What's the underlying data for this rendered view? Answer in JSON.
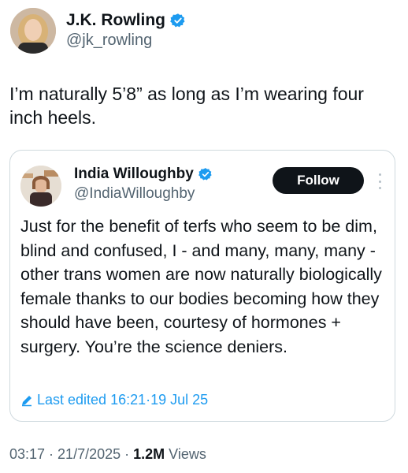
{
  "author": {
    "name": "J.K. Rowling",
    "handle": "@jk_rowling",
    "verified": true
  },
  "tweet": {
    "text": "I’m naturally 5’8” as long as I’m wearing four inch heels."
  },
  "quoted": {
    "name": "India Willoughby",
    "handle": "@IndiaWilloughby",
    "follow_label": "Follow",
    "text": "Just for the benefit of terfs who seem to be dim, blind and confused, I - and many, many, many - other trans women are now naturally biologically female thanks to our bodies becoming how they should have been, courtesy of hormones + surgery. You’re the science deniers.",
    "edited_label": "Last edited 16:21",
    "edited_sep": " · ",
    "edited_date": "19 Jul 25"
  },
  "meta": {
    "time": "03:17",
    "sep1": " · ",
    "date": "21/7/2025",
    "sep2": " · ",
    "views_count": "1.2M",
    "views_label": " Views"
  },
  "colors": {
    "verified_blue": "#1d9bf0",
    "text": "#0f1419",
    "secondary": "#536471",
    "border": "#cfd9de"
  }
}
